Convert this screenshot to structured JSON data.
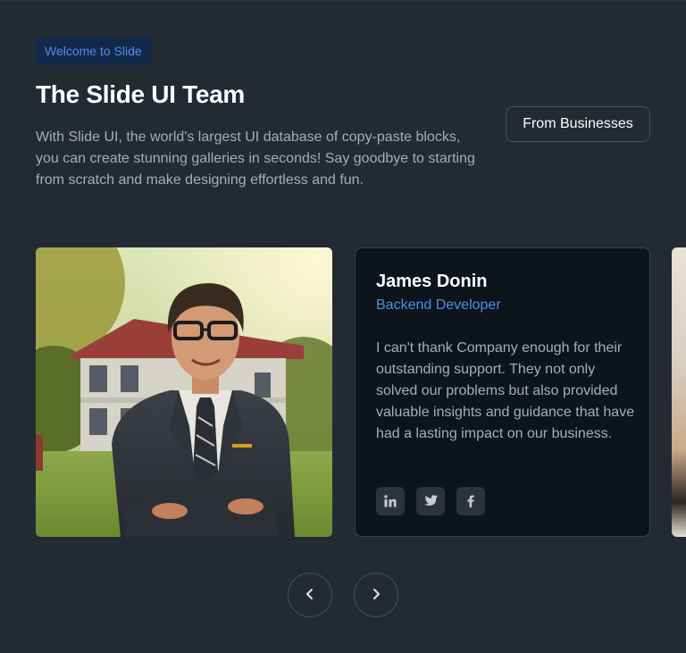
{
  "header": {
    "badge": "Welcome to Slide",
    "title": "The Slide UI Team",
    "description": "With Slide UI, the world's largest UI database of copy-paste blocks, you can create stunning galleries in seconds! Say goodbye to starting from scratch and make designing effortless and fun.",
    "filter_button": "From Businesses"
  },
  "team_card": {
    "name": "James Donin",
    "role": "Backend Developer",
    "quote": "I can't thank Company enough for their outstanding support. They not only solved our problems but also provided valuable insights and guidance that have had a lasting impact on our business.",
    "socials": [
      "linkedin-icon",
      "twitter-icon",
      "facebook-icon"
    ]
  },
  "carousel": {
    "prev_icon": "chevron-left-icon",
    "next_icon": "chevron-right-icon"
  },
  "colors": {
    "background": "#242a31",
    "accent": "#4e8ee6",
    "card": "#0e141c"
  }
}
